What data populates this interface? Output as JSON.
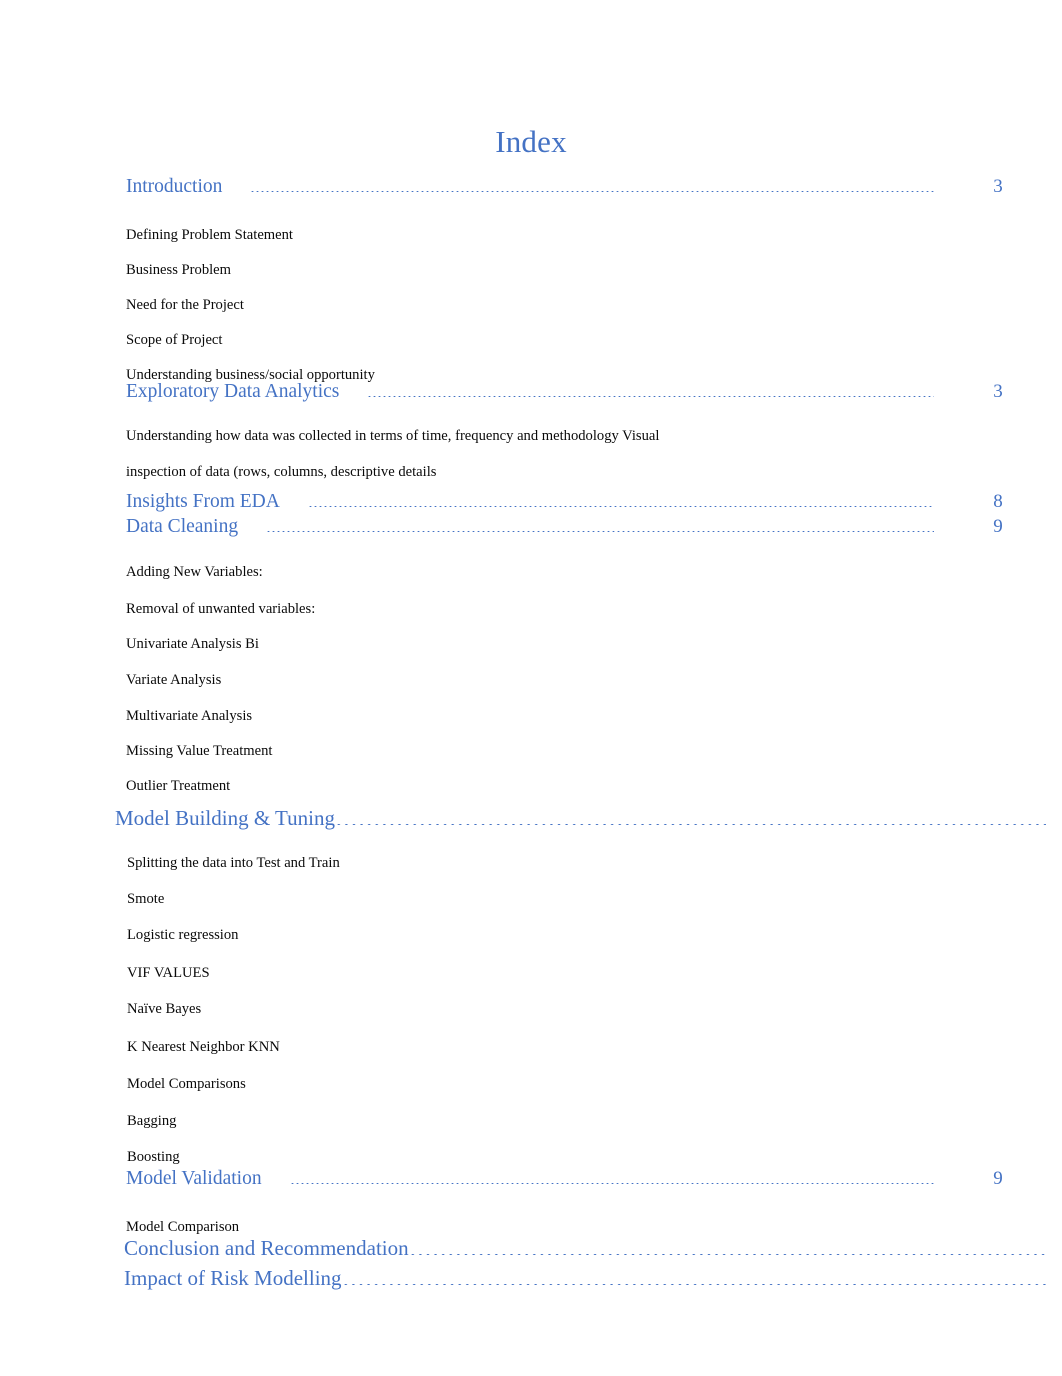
{
  "document": {
    "title": "Index",
    "accent_color": "#4472C4",
    "text_color": "#000000",
    "background_color": "#FFFFFF"
  },
  "toc": {
    "entries": [
      {
        "kind": "heading",
        "label": "Introduction",
        "page": "3"
      },
      {
        "kind": "sub",
        "label": "Defining Problem Statement"
      },
      {
        "kind": "sub",
        "label": "Business Problem"
      },
      {
        "kind": "sub",
        "label": "Need for the Project"
      },
      {
        "kind": "sub",
        "label": "Scope of Project"
      },
      {
        "kind": "sub",
        "label": "Understanding business/social opportunity"
      },
      {
        "kind": "heading",
        "label": "Exploratory Data Analytics",
        "page": "3"
      },
      {
        "kind": "sub",
        "label": "Understanding how data was collected in terms of time, frequency and methodology Visual"
      },
      {
        "kind": "sub",
        "label": "inspection of data (rows, columns, descriptive details"
      },
      {
        "kind": "heading",
        "label": "Insights From EDA",
        "page": "8"
      },
      {
        "kind": "heading",
        "label": "Data Cleaning",
        "page": "9"
      },
      {
        "kind": "sub",
        "label": "Adding New Variables:"
      },
      {
        "kind": "sub",
        "label": "Removal of unwanted variables:"
      },
      {
        "kind": "sub",
        "label": "Univariate Analysis Bi"
      },
      {
        "kind": "sub",
        "label": "Variate Analysis"
      },
      {
        "kind": "sub",
        "label": "Multivariate Analysis"
      },
      {
        "kind": "sub",
        "label": "Missing Value Treatment"
      },
      {
        "kind": "sub",
        "label": "Outlier Treatment"
      },
      {
        "kind": "heading-dots",
        "label": "Model Building & Tuning"
      },
      {
        "kind": "sub",
        "label": "Splitting the data into Test and Train"
      },
      {
        "kind": "sub",
        "label": "Smote"
      },
      {
        "kind": "sub",
        "label": "Logistic regression"
      },
      {
        "kind": "sub",
        "label": "VIF VALUES"
      },
      {
        "kind": "sub",
        "label": "Naïve Bayes"
      },
      {
        "kind": "sub",
        "label": "K Nearest Neighbor KNN"
      },
      {
        "kind": "sub",
        "label": "Model Comparisons"
      },
      {
        "kind": "sub",
        "label": "Bagging"
      },
      {
        "kind": "sub",
        "label": "Boosting"
      },
      {
        "kind": "heading",
        "label": "Model Validation",
        "page": "9"
      },
      {
        "kind": "sub",
        "label": "Model Comparison"
      },
      {
        "kind": "heading-dots",
        "label": "Conclusion and Recommendation"
      },
      {
        "kind": "heading-dots",
        "label": "Impact of Risk Modelling"
      }
    ]
  }
}
